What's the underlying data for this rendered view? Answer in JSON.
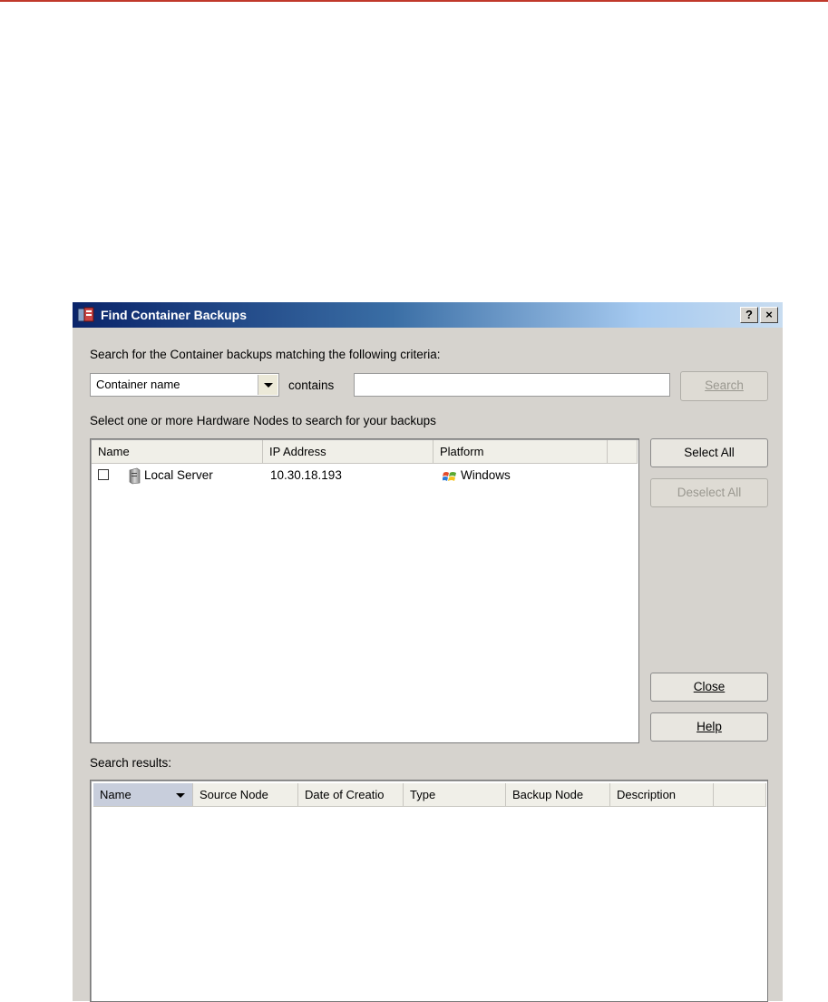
{
  "dialog": {
    "title": "Find Container Backups",
    "help_btn": "?",
    "close_btn": "×"
  },
  "criteria": {
    "label": "Search for the Container backups matching the following criteria:",
    "field_selected": "Container name",
    "operator": "contains",
    "query_value": "",
    "query_placeholder": "",
    "search_label": "Search"
  },
  "nodes": {
    "label": "Select one or more Hardware Nodes to search for your backups",
    "columns": [
      "Name",
      "IP Address",
      "Platform"
    ],
    "rows": [
      {
        "name": "Local Server",
        "ip": "10.30.18.193",
        "platform": "Windows",
        "checked": false
      }
    ],
    "select_all_label": "Select All",
    "deselect_all_label": "Deselect All",
    "close_label": "Close",
    "help_label": "Help"
  },
  "results": {
    "label": "Search results:",
    "columns": [
      "Name",
      "Source Node",
      "Date of Creatio",
      "Type",
      "Backup Node",
      "Description"
    ]
  },
  "colors": {
    "accent_rule": "#c0392b",
    "titlebar_start": "#0a246a",
    "dialog_bg": "#d6d3ce"
  }
}
